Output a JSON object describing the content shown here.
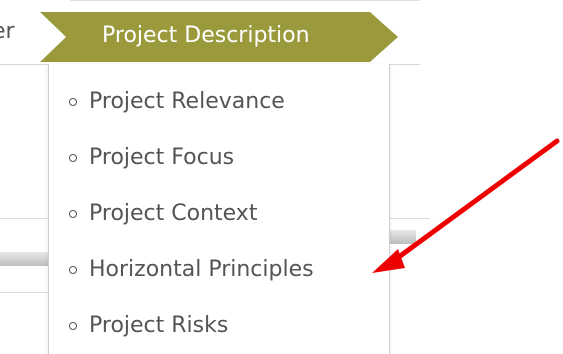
{
  "nav": {
    "previous_step_label": "er",
    "active_step_label": "Project Description",
    "active_color": "#9a9a3c"
  },
  "dropdown": {
    "items": [
      {
        "label": "Project Relevance"
      },
      {
        "label": "Project Focus"
      },
      {
        "label": "Project Context"
      },
      {
        "label": "Horizontal Principles"
      },
      {
        "label": "Project Risks"
      }
    ]
  },
  "annotation": {
    "arrow_color": "#ee0000",
    "arrow_target": "Horizontal Principles"
  }
}
